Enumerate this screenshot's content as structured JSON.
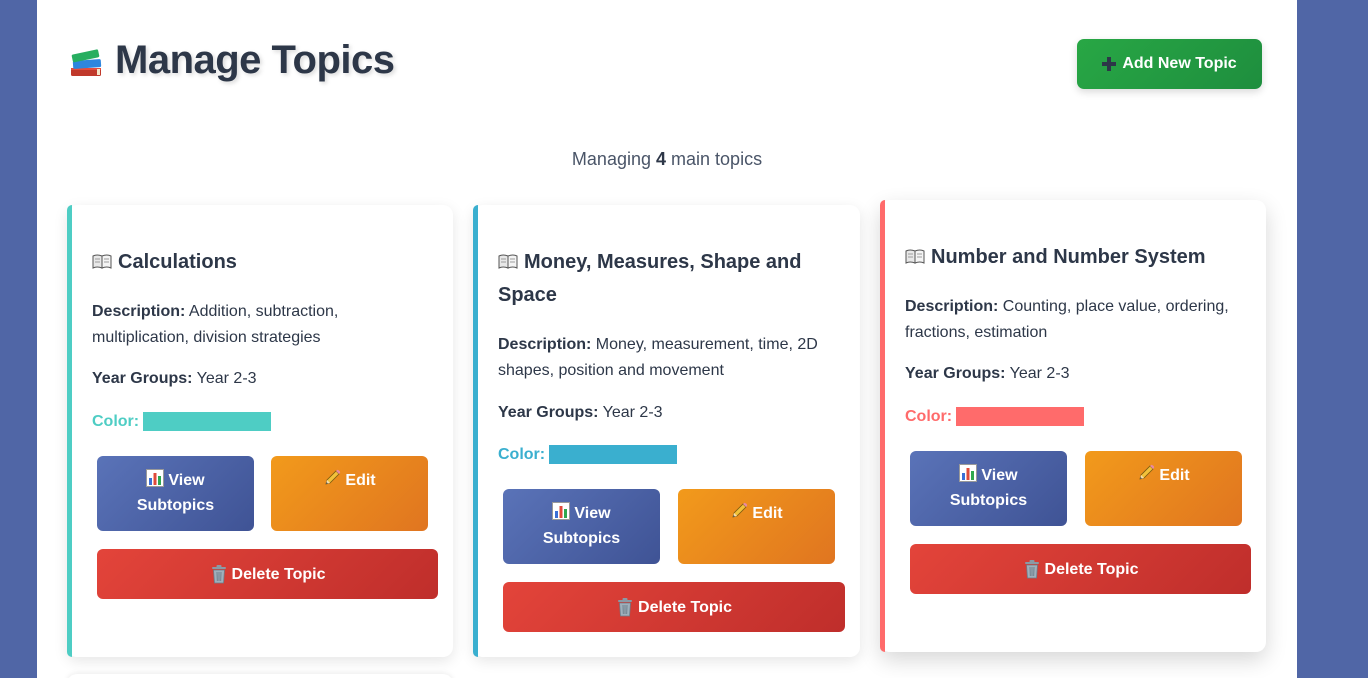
{
  "header": {
    "title": "Manage Topics",
    "add_button_label": "Add New Topic"
  },
  "summary": {
    "prefix": "Managing",
    "count": "4",
    "suffix": "main topics"
  },
  "labels": {
    "description": "Description:",
    "year_groups": "Year Groups:",
    "color": "Color:",
    "view_line1": "View",
    "view_line2": "Subtopics",
    "edit": "Edit",
    "delete": "Delete Topic"
  },
  "topics": [
    {
      "title": "Calculations",
      "description": "Addition, subtraction, multiplication, division strategies",
      "year_groups": "Year 2-3",
      "color": "#4ecdc4"
    },
    {
      "title": "Money, Measures, Shape and Space",
      "description": "Money, measurement, time, 2D shapes, position and movement",
      "year_groups": "Year 2-3",
      "color": "#3aafcf"
    },
    {
      "title": "Number and Number System",
      "description": "Counting, place value, ordering, fractions, estimation",
      "year_groups": "Year 2-3",
      "color": "#ff6b6b"
    }
  ],
  "colors": {
    "background": "#5066a6",
    "add_button": "#28a745",
    "view_button": "#4f67a8",
    "edit_button": "#ee8e1c",
    "delete_button": "#d63a33"
  },
  "icons": {
    "title": "books-icon",
    "add": "plus-icon",
    "topic": "book-icon",
    "view": "bar-chart-icon",
    "edit": "pencil-icon",
    "delete": "trash-icon"
  }
}
